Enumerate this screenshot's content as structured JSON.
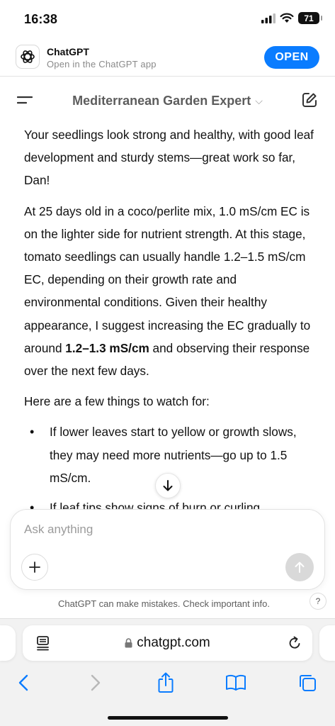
{
  "status": {
    "time": "16:38",
    "battery": "71"
  },
  "banner": {
    "app_name": "ChatGPT",
    "subtitle": "Open in the ChatGPT app",
    "open_label": "OPEN"
  },
  "header": {
    "title": "Mediterranean Garden Expert"
  },
  "message": {
    "p1": "Your seedlings look strong and healthy, with good leaf development and sturdy stems—great work so far, Dan!",
    "p2_before": "At 25 days old in a coco/perlite mix, 1.0 mS/cm EC is on the lighter side for nutrient strength. At this stage, tomato seedlings can usually handle 1.2–1.5 mS/cm EC, depending on their growth rate and environmental conditions. Given their healthy appearance, I suggest increasing the EC gradually to around ",
    "p2_bold": "1.2–1.3 mS/cm",
    "p2_after": " and observing their response over the next few days.",
    "p3": "Here are a few things to watch for:",
    "bullets": [
      "If lower leaves start to yellow or growth slows, they may need more nutrients—go up to 1.5 mS/cm.",
      "If leaf tips show signs of burn or curling,"
    ]
  },
  "composer": {
    "placeholder": "Ask anything"
  },
  "disclaimer": "ChatGPT can make mistakes. Check important info.",
  "help_label": "?",
  "safari": {
    "url": "chatgpt.com"
  }
}
